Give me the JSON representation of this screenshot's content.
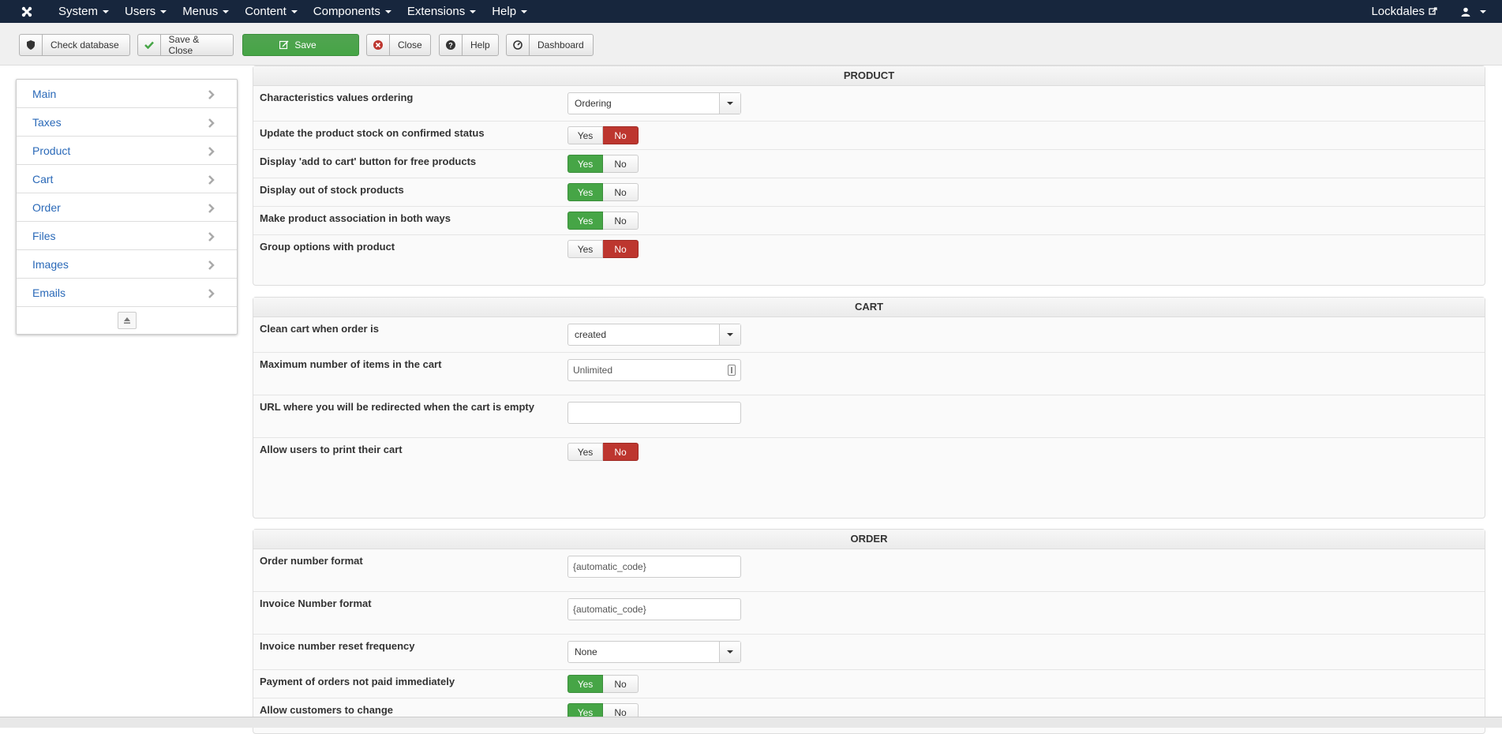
{
  "navbar": {
    "logo_icon": "joomla-logo-icon",
    "menu": [
      {
        "label": "System"
      },
      {
        "label": "Users"
      },
      {
        "label": "Menus"
      },
      {
        "label": "Content"
      },
      {
        "label": "Components"
      },
      {
        "label": "Extensions"
      },
      {
        "label": "Help"
      }
    ],
    "site_name": "Lockdales",
    "user_icon": "user-icon"
  },
  "toolbar": {
    "check_database": "Check database",
    "save_close": "Save & Close",
    "save": "Save",
    "close": "Close",
    "help": "Help",
    "dashboard": "Dashboard"
  },
  "sidebar": {
    "items": [
      {
        "label": "Main"
      },
      {
        "label": "Taxes"
      },
      {
        "label": "Product"
      },
      {
        "label": "Cart"
      },
      {
        "label": "Order"
      },
      {
        "label": "Files"
      },
      {
        "label": "Images"
      },
      {
        "label": "Emails"
      }
    ]
  },
  "product": {
    "title": "PRODUCT",
    "rows": [
      {
        "label": "Characteristics values ordering",
        "type": "select",
        "value": "Ordering"
      },
      {
        "label": "Update the product stock on confirmed status",
        "type": "toggle",
        "value": "No"
      },
      {
        "label": "Display 'add to cart' button for free products",
        "type": "toggle",
        "value": "Yes"
      },
      {
        "label": "Display out of stock products",
        "type": "toggle",
        "value": "Yes"
      },
      {
        "label": "Make product association in both ways",
        "type": "toggle",
        "value": "Yes"
      },
      {
        "label": "Group options with product",
        "type": "toggle",
        "value": "No"
      }
    ]
  },
  "cart": {
    "title": "CART",
    "rows": [
      {
        "label": "Clean cart when order is",
        "type": "select",
        "value": "created"
      },
      {
        "label": "Maximum number of items in the cart",
        "type": "input",
        "value": "Unlimited"
      },
      {
        "label": "URL where you will be redirected when the cart is empty",
        "type": "input",
        "value": ""
      },
      {
        "label": "Allow users to print their cart",
        "type": "toggle",
        "value": "No"
      }
    ]
  },
  "order": {
    "title": "ORDER",
    "rows": [
      {
        "label": "Order number format",
        "type": "input",
        "value": "{automatic_code}"
      },
      {
        "label": "Invoice Number format",
        "type": "input",
        "value": "{automatic_code}"
      },
      {
        "label": "Invoice number reset frequency",
        "type": "select",
        "value": "None"
      },
      {
        "label": "Payment of orders not paid immediately",
        "type": "toggle",
        "value": "Yes"
      },
      {
        "label": "Allow customers to change",
        "type": "toggle",
        "value": "Yes"
      }
    ]
  },
  "toggle_labels": {
    "yes": "Yes",
    "no": "No"
  },
  "colors": {
    "navbar": "#17263d",
    "save_green": "#46a546",
    "no_red": "#bd362f",
    "link_blue": "#2a69b8"
  }
}
